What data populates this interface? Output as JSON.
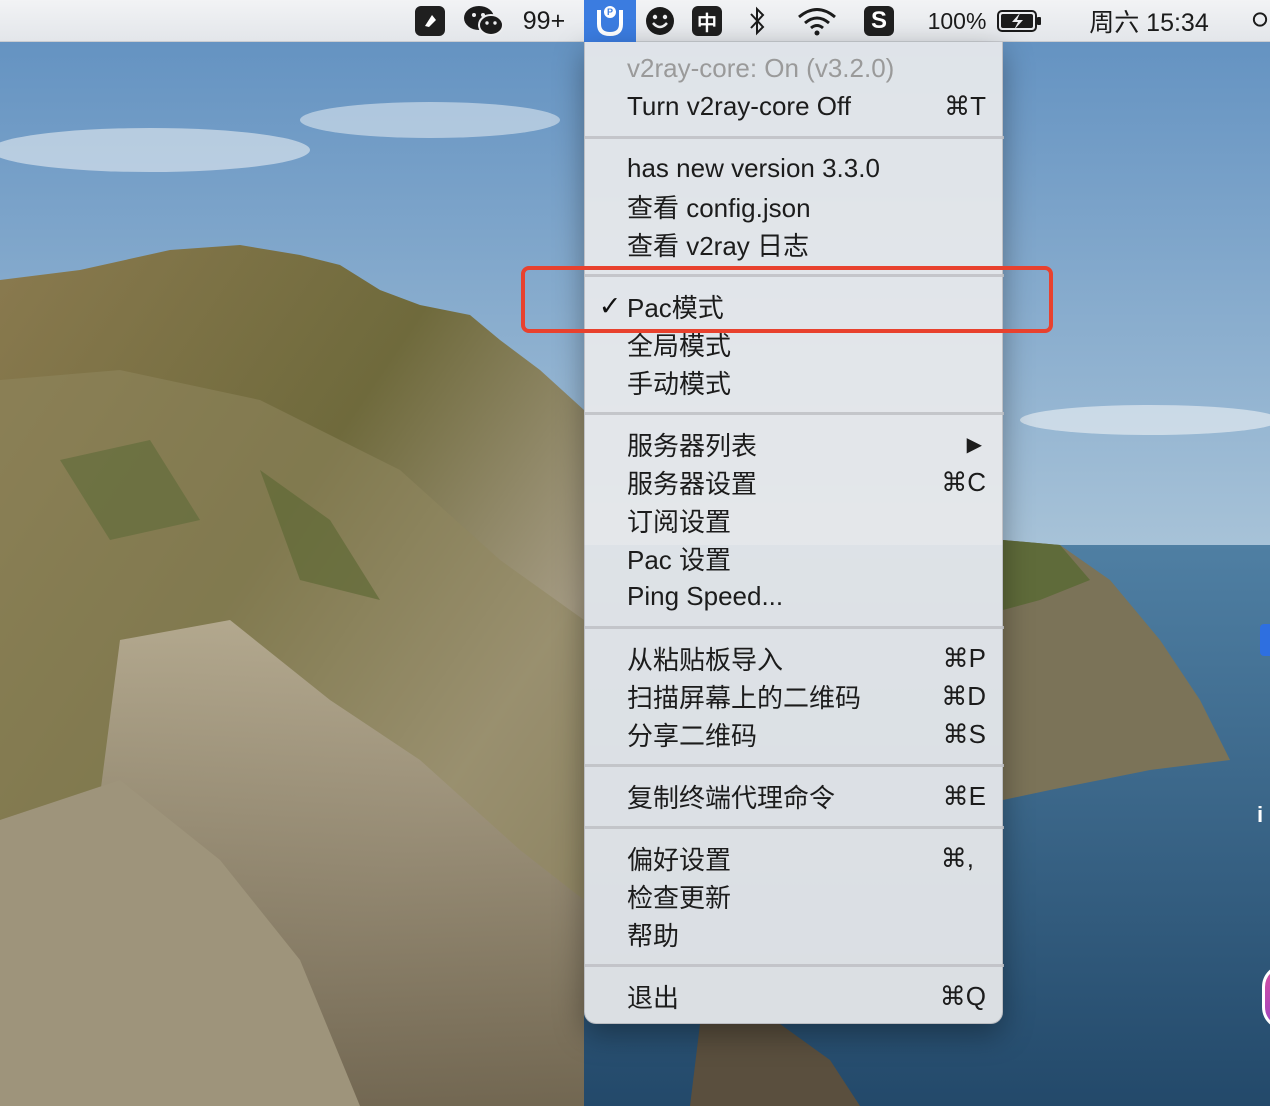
{
  "menubar": {
    "badge_count": "99+",
    "input_method": "中",
    "battery": "100%",
    "clock": "周六 15:34"
  },
  "menu": {
    "status": "v2ray-core: On  (v3.2.0)",
    "toggle": {
      "label": "Turn v2ray-core Off",
      "shortcut": "⌘T"
    },
    "new_version": "has new version 3.3.0",
    "view_config": "查看 config.json",
    "view_log": "查看 v2ray 日志",
    "modes": [
      {
        "label": "Pac模式",
        "checked": true
      },
      {
        "label": "全局模式",
        "checked": false
      },
      {
        "label": "手动模式",
        "checked": false
      }
    ],
    "check_mark": "✓",
    "server_list": "服务器列表",
    "server_settings": {
      "label": "服务器设置",
      "shortcut": "⌘C"
    },
    "subscription_settings": "订阅设置",
    "pac_settings": "Pac 设置",
    "ping_speed": "Ping Speed...",
    "import_clipboard": {
      "label": "从粘贴板导入",
      "shortcut": "⌘P"
    },
    "scan_qr": {
      "label": "扫描屏幕上的二维码",
      "shortcut": "⌘D"
    },
    "share_qr": {
      "label": "分享二维码",
      "shortcut": "⌘S"
    },
    "copy_proxy_cmd": {
      "label": "复制终端代理命令",
      "shortcut": "⌘E"
    },
    "preferences": {
      "label": "偏好设置",
      "shortcut": "⌘,"
    },
    "check_updates": "检查更新",
    "help": "帮助",
    "quit": {
      "label": "退出",
      "shortcut": "⌘Q"
    }
  },
  "edge_text": "i",
  "colors": {
    "highlight": "#e8412e",
    "menubar_active": "#3b7ce0",
    "menu_bg": "#e8e9ec"
  },
  "icons": [
    "dark-square-app-icon",
    "wechat-icon",
    "v2rayu-icon",
    "smiley-icon",
    "bluetooth-icon",
    "wifi-icon",
    "sogou-icon",
    "battery-icon",
    "search-icon"
  ]
}
